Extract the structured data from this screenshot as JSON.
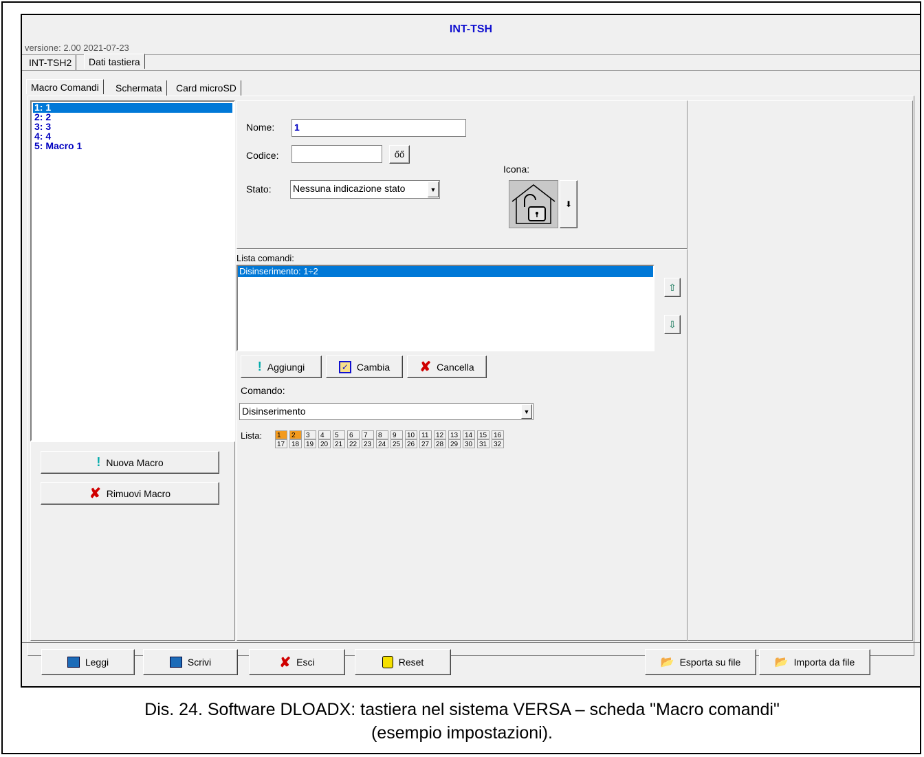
{
  "window": {
    "title": "INT-TSH",
    "version": "versione: 2.00 2021-07-23",
    "top_tabs": [
      "INT-TSH2",
      "Dati tastiera"
    ],
    "sub_tabs": [
      "Macro Comandi",
      "Schermata",
      "Card microSD"
    ]
  },
  "macro_list": {
    "items": [
      "1: 1",
      "2: 2",
      "3: 3",
      "4: 4",
      "5: Macro 1"
    ],
    "selected_index": 0
  },
  "macro_buttons": {
    "new_label": "Nuova Macro",
    "remove_label": "Rimuovi Macro"
  },
  "form": {
    "nome_label": "Nome:",
    "nome_value": "1",
    "codice_label": "Codice:",
    "codice_value": "",
    "codice_button": "őő",
    "stato_label": "Stato:",
    "stato_value": "Nessuna indicazione stato",
    "icona_label": "Icona:",
    "icona_name": "house-unlocked-icon"
  },
  "commands": {
    "label": "Lista comandi:",
    "items": [
      "Disinserimento: 1÷2"
    ],
    "add_label": "Aggiungi",
    "change_label": "Cambia",
    "delete_label": "Cancella",
    "comando_label": "Comando:",
    "comando_value": "Disinserimento",
    "lista_label": "Lista:",
    "lista_numbers": [
      "1",
      "2",
      "3",
      "4",
      "5",
      "6",
      "7",
      "8",
      "9",
      "10",
      "11",
      "12",
      "13",
      "14",
      "15",
      "16",
      "17",
      "18",
      "19",
      "20",
      "21",
      "22",
      "23",
      "24",
      "25",
      "26",
      "27",
      "28",
      "29",
      "30",
      "31",
      "32"
    ],
    "lista_selected": [
      "1",
      "2"
    ]
  },
  "bottom": {
    "read_label": "Leggi",
    "write_label": "Scrivi",
    "exit_label": "Esci",
    "reset_label": "Reset",
    "export_label": "Esporta su file",
    "import_label": "Importa da file"
  },
  "caption": {
    "line1": "Dis. 24. Software DLOADX: tastiera nel sistema VERSA – scheda \"Macro comandi\"",
    "line2": "(esempio impostazioni)."
  },
  "colors": {
    "accent": "#0078d7",
    "title": "#1010d0",
    "list_text": "#0000c0",
    "selected_cell": "#f39a1e"
  }
}
